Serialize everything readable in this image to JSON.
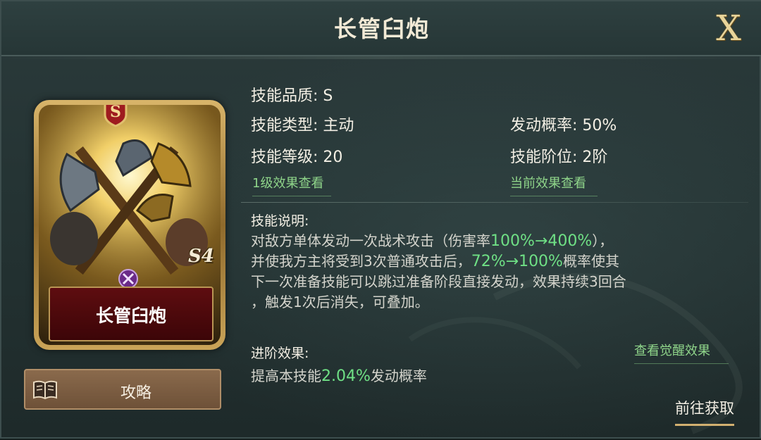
{
  "header": {
    "title": "长管臼炮",
    "close_label": "X"
  },
  "card": {
    "grade": "S",
    "name": "长管臼炮",
    "level_tag": "S4"
  },
  "guide_button": {
    "label": "攻略"
  },
  "info": {
    "quality": "技能品质: S",
    "type": "技能类型: 主动",
    "level": "技能等级: 20",
    "trigger_rate": "发动概率: 50%",
    "rank": "技能阶位: 2阶",
    "link_level1": "1级效果查看",
    "link_current": "当前效果查看"
  },
  "description": {
    "title": "技能说明:",
    "l1a": "对敌方单体发动一次战术攻击（伤害率",
    "l1hl": "100%→400%",
    "l1b": "），",
    "l2a": "并使我方主将受到3次普通攻击后，",
    "l2hl": "72%→100%",
    "l2b": "概率使其",
    "l3": "下一次准备技能可以跳过准备阶段直接发动，效果持续3回合",
    "l4": "，触发1次后消失，可叠加。"
  },
  "advance": {
    "title": "进阶效果:",
    "text_a": "提高本技能",
    "text_hl": "2.04%",
    "text_b": "发动概率",
    "awaken_link": "查看觉醒效果"
  },
  "go_button": {
    "label": "前往获取"
  },
  "colors": {
    "highlight": "#6fe085",
    "link": "#8fd58a",
    "gold": "#d2b070"
  }
}
